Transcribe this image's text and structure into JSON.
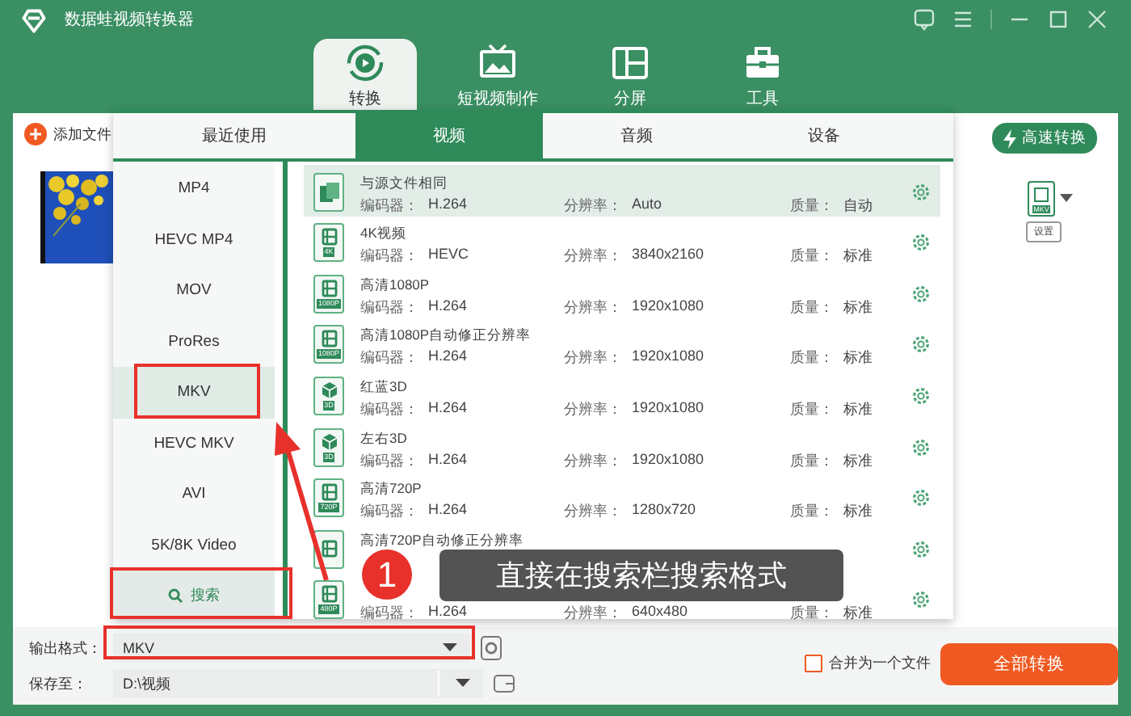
{
  "window": {
    "title": "数据蛙视频转换器"
  },
  "nav": [
    {
      "label": "转换",
      "kind": "convert",
      "selected": true
    },
    {
      "label": "短视频制作",
      "kind": "video",
      "selected": false
    },
    {
      "label": "分屏",
      "kind": "split",
      "selected": false
    },
    {
      "label": "工具",
      "kind": "tools",
      "selected": false
    }
  ],
  "main": {
    "add_file": "添加文件",
    "fast_convert": "高速转换",
    "file_format": "MKV",
    "settings": "设置"
  },
  "popup": {
    "tabs": [
      {
        "label": "最近使用",
        "selected": false
      },
      {
        "label": "视频",
        "selected": true
      },
      {
        "label": "音频",
        "selected": false
      },
      {
        "label": "设备",
        "selected": false
      }
    ],
    "formats": [
      {
        "label": "MP4",
        "selected": false
      },
      {
        "label": "HEVC MP4",
        "selected": false
      },
      {
        "label": "MOV",
        "selected": false
      },
      {
        "label": "ProRes",
        "selected": false
      },
      {
        "label": "MKV",
        "selected": true
      },
      {
        "label": "HEVC MKV",
        "selected": false
      },
      {
        "label": "AVI",
        "selected": false
      },
      {
        "label": "5K/8K Video",
        "selected": false
      }
    ],
    "search": "搜索",
    "presets": [
      {
        "name": "与源文件相同",
        "kind": "copy",
        "selected": true,
        "fields": [
          {
            "label": "编码器：",
            "value": "H.264"
          },
          {
            "label": "分辨率：",
            "value": "Auto"
          },
          {
            "label": "质量：",
            "value": "自动"
          }
        ]
      },
      {
        "name": "4K视频",
        "kind": "film",
        "badge": "4K",
        "selected": false,
        "fields": [
          {
            "label": "编码器：",
            "value": "HEVC"
          },
          {
            "label": "分辨率：",
            "value": "3840x2160"
          },
          {
            "label": "质量：",
            "value": "标准"
          }
        ]
      },
      {
        "name": "高清1080P",
        "kind": "film",
        "badge": "1080P",
        "selected": false,
        "fields": [
          {
            "label": "编码器：",
            "value": "H.264"
          },
          {
            "label": "分辨率：",
            "value": "1920x1080"
          },
          {
            "label": "质量：",
            "value": "标准"
          }
        ]
      },
      {
        "name": "高清1080P自动修正分辨率",
        "kind": "film",
        "badge": "1080P",
        "selected": false,
        "fields": [
          {
            "label": "编码器：",
            "value": "H.264"
          },
          {
            "label": "分辨率：",
            "value": "1920x1080"
          },
          {
            "label": "质量：",
            "value": "标准"
          }
        ]
      },
      {
        "name": "红蓝3D",
        "kind": "cube",
        "badge": "3D",
        "selected": false,
        "fields": [
          {
            "label": "编码器：",
            "value": "H.264"
          },
          {
            "label": "分辨率：",
            "value": "1920x1080"
          },
          {
            "label": "质量：",
            "value": "标准"
          }
        ]
      },
      {
        "name": "左右3D",
        "kind": "cube",
        "badge": "3D",
        "selected": false,
        "fields": [
          {
            "label": "编码器：",
            "value": "H.264"
          },
          {
            "label": "分辨率：",
            "value": "1920x1080"
          },
          {
            "label": "质量：",
            "value": "标准"
          }
        ]
      },
      {
        "name": "高清720P",
        "kind": "film",
        "badge": "720P",
        "selected": false,
        "fields": [
          {
            "label": "编码器：",
            "value": "H.264"
          },
          {
            "label": "分辨率：",
            "value": "1280x720"
          },
          {
            "label": "质量：",
            "value": "标准"
          }
        ]
      },
      {
        "name": "高清720P自动修正分辨率",
        "kind": "film",
        "selected": false
      },
      {
        "kind": "film",
        "badge": "480P",
        "selected": false,
        "fields": [
          {
            "label": "编码器：",
            "value": "H.264"
          },
          {
            "label": "分辨率：",
            "value": "640x480"
          },
          {
            "label": "质量：",
            "value": "标准"
          }
        ]
      }
    ]
  },
  "annotation": {
    "marker": "1",
    "text": "直接在搜索栏搜索格式"
  },
  "bottom": {
    "output_label": "输出格式：",
    "output_value": "MKV",
    "save_label": "保存至：",
    "save_path": "D:\\视频",
    "merge": {
      "label": "合并为一个文件",
      "checked": false
    },
    "convert_all": "全部转换"
  }
}
